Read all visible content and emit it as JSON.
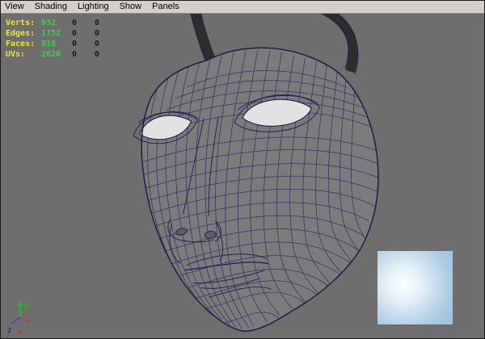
{
  "menu": {
    "items": [
      "View",
      "Shading",
      "Lighting",
      "Show",
      "Panels"
    ]
  },
  "hud": {
    "rows": [
      {
        "label": "Verts:",
        "value": "932",
        "extra1": "0",
        "extra2": "0"
      },
      {
        "label": "Edges:",
        "value": "1752",
        "extra1": "0",
        "extra2": "0"
      },
      {
        "label": "Faces:",
        "value": "818",
        "extra1": "0",
        "extra2": "0"
      },
      {
        "label": "UVs:",
        "value": "2626",
        "extra1": "0",
        "extra2": "0"
      }
    ]
  },
  "axis": {
    "x": "x",
    "y": "y",
    "z": "z"
  },
  "colors": {
    "menubar_bg": "#d4d0c8",
    "viewport_bg": "#6e6e6e",
    "face_fill": "#7b7b7b",
    "wireframe": "#2b2b66",
    "hud_label": "#efe52c",
    "hud_value": "#3cd14e",
    "axis_x": "#d03030",
    "axis_y": "#19c619",
    "axis_z": "#202080"
  }
}
